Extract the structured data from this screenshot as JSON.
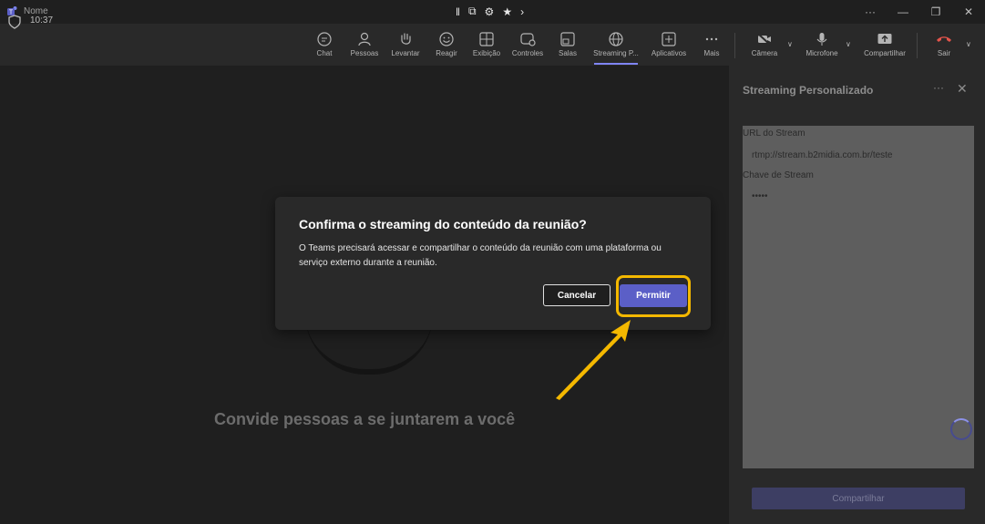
{
  "titlebar": {
    "app_name": "Nome",
    "more_label": "···"
  },
  "meeting": {
    "time": "10:37"
  },
  "toolbar": {
    "items": [
      {
        "label": "Chat",
        "icon": "chat-icon"
      },
      {
        "label": "Pessoas",
        "icon": "people-icon"
      },
      {
        "label": "Levantar",
        "icon": "raise-hand-icon"
      },
      {
        "label": "Reagir",
        "icon": "smile-icon"
      },
      {
        "label": "Exibição",
        "icon": "grid-icon"
      },
      {
        "label": "Controles",
        "icon": "controls-icon"
      },
      {
        "label": "Salas",
        "icon": "rooms-icon"
      },
      {
        "label": "Streaming P...",
        "icon": "globe-icon"
      },
      {
        "label": "Aplicativos",
        "icon": "plus-square-icon"
      },
      {
        "label": "Mais",
        "icon": "more-icon"
      },
      {
        "label": "Câmera",
        "icon": "camera-off-icon"
      },
      {
        "label": "Microfone",
        "icon": "mic-icon"
      },
      {
        "label": "Compartilhar",
        "icon": "share-tray-icon"
      },
      {
        "label": "Sair",
        "icon": "hangup-icon"
      }
    ]
  },
  "stage": {
    "invite_text": "Convide pessoas a se juntarem a você"
  },
  "panel": {
    "title": "Streaming Personalizado",
    "url_label": "URL do Stream",
    "url_value": "rtmp://stream.b2midia.com.br/teste",
    "key_label": "Chave de Stream",
    "key_value": "•••••",
    "share_button": "Compartilhar"
  },
  "dialog": {
    "title": "Confirma o streaming do conteúdo da reunião?",
    "body": "O Teams precisará acessar e compartilhar o conteúdo da reunião com uma plataforma ou serviço externo durante a reunião.",
    "cancel_label": "Cancelar",
    "allow_label": "Permitir"
  },
  "colors": {
    "accent": "#5b5fc7",
    "highlight": "#f4b800",
    "hangup": "#e4544b"
  }
}
